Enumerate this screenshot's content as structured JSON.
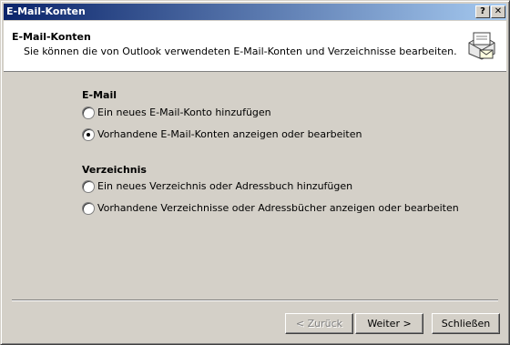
{
  "window": {
    "title": "E-Mail-Konten",
    "help_label": "?",
    "close_label": "✕"
  },
  "header": {
    "title": "E-Mail-Konten",
    "subtitle": "Sie können die von Outlook verwendeten E-Mail-Konten und Verzeichnisse bearbeiten.",
    "icon": "mail-accounts-icon"
  },
  "email_group": {
    "label": "E-Mail",
    "options": [
      {
        "label": "Ein neues E-Mail-Konto hinzufügen",
        "checked": false
      },
      {
        "label": "Vorhandene E-Mail-Konten anzeigen oder bearbeiten",
        "checked": true
      }
    ]
  },
  "directory_group": {
    "label": "Verzeichnis",
    "options": [
      {
        "label": "Ein neues Verzeichnis oder Adressbuch hinzufügen",
        "checked": false
      },
      {
        "label": "Vorhandene Verzeichnisse oder Adressbücher anzeigen oder bearbeiten",
        "checked": false
      }
    ]
  },
  "buttons": {
    "back_label": "< Zurück",
    "next_label": "Weiter >",
    "close_label": "Schließen"
  }
}
